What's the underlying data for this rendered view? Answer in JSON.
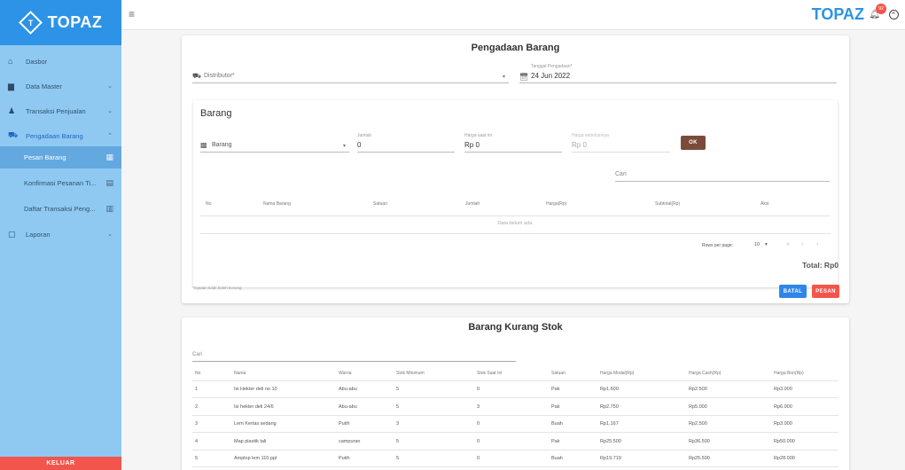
{
  "app": {
    "brand": "TOPAZ",
    "logo_letter": "T",
    "notification_count": "92"
  },
  "sidebar": {
    "items": [
      {
        "label": "Dasbor",
        "icon": "home-icon",
        "glyph": "⌂"
      },
      {
        "label": "Data Master",
        "icon": "briefcase-icon",
        "glyph": "▆"
      },
      {
        "label": "Transaksi Penjualan",
        "icon": "person-icon",
        "glyph": "⛹"
      },
      {
        "label": "Pengadaan Barang",
        "icon": "cart-icon",
        "glyph": "⛟"
      }
    ],
    "subitems": [
      {
        "label": "Pesan Barang",
        "glyph": "▦"
      },
      {
        "label": "Konfirmasi Pesanan Ti...",
        "glyph": "▤"
      },
      {
        "label": "Daftar Transaksi Peng...",
        "glyph": "▥"
      }
    ],
    "report": {
      "label": "Laporan",
      "glyph": "▢"
    },
    "logout_label": "KELUAR"
  },
  "order": {
    "title": "Pengadaan Barang",
    "distributor_placeholder": "Distributor*",
    "date_label": "Tanggal Pengadaan*",
    "date_value": "24 Jun 2022",
    "section_title": "Barang",
    "item_placeholder": "Barang",
    "qty_label": "Jumlah",
    "qty_value": "0",
    "price_label": "Harga saat ini",
    "price_value": "Rp 0",
    "prev_price_label": "Harga sebelumnya",
    "prev_price_value": "Rp 0",
    "ok_label": "OK",
    "search_label": "Cari",
    "columns": [
      "No",
      "Nama Barang",
      "Satuan",
      "Jumlah",
      "Harga(Rp)",
      "Subtotal(Rp)",
      "Aksi"
    ],
    "empty_text": "Data belum ada.",
    "rows_per_page_label": "Rows per page:",
    "rows_per_page_value": "10",
    "total_label": "Total: Rp0",
    "required_note": "*Inputan tidak boleh kosong",
    "cancel_label": "BATAL",
    "submit_label": "PESAN"
  },
  "low_stock": {
    "title": "Barang Kurang Stok",
    "search_label": "Cari",
    "columns": [
      "No",
      "Nama",
      "Warna",
      "Stok Minimum",
      "Stok Saat Ini",
      "Satuan",
      "Harga Modal(Rp)",
      "Harga Cash(Rp)",
      "Harga Bon(Rp)"
    ],
    "rows": [
      [
        "1",
        "Isi Hekter deli no 10",
        "Abu-abu",
        "5",
        "0",
        "Pak",
        "Rp1.600",
        "Rp2.500",
        "Rp3.000"
      ],
      [
        "2",
        "Isi hekter deli 24/6",
        "Abu-abu",
        "5",
        "3",
        "Pak",
        "Rp2.750",
        "Rp5.000",
        "Rp6.000"
      ],
      [
        "3",
        "Lem Kertas sedang",
        "Putih",
        "3",
        "0",
        "Buah",
        "Rp1.167",
        "Rp2.500",
        "Rp3.000"
      ],
      [
        "4",
        "Map plastik tali",
        "campuran",
        "5",
        "0",
        "Pak",
        "Rp25.500",
        "Rp36.500",
        "Rp50.000"
      ],
      [
        "5",
        "Amplop lem 110 ppl",
        "Putih",
        "5",
        "0",
        "Buah",
        "Rp19.719",
        "Rp25.500",
        "Rp28.000"
      ]
    ]
  },
  "colors": {
    "primary": "#2c93e6",
    "sidebar": "#8fc9f2",
    "danger": "#f2554c",
    "ok_button": "#7a4b3a",
    "cancel_button": "#2e86e8"
  }
}
